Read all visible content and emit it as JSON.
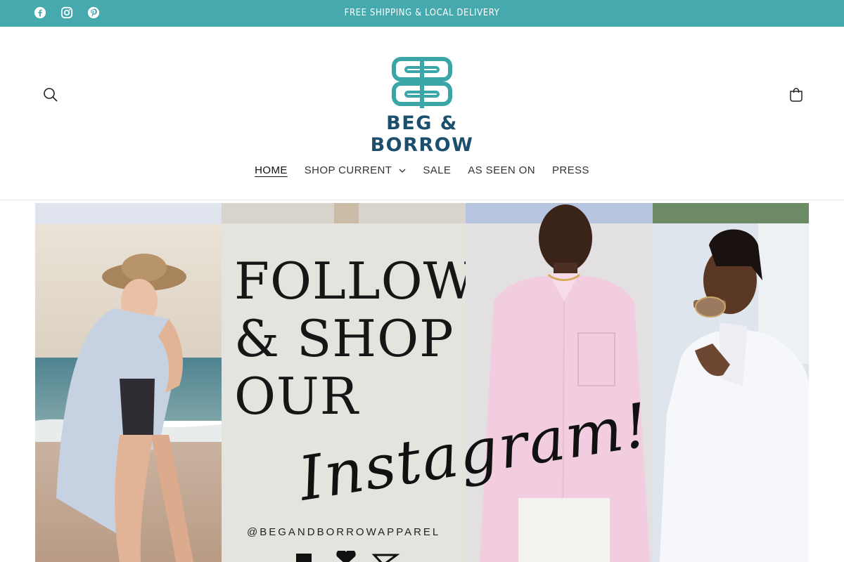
{
  "announcement": {
    "text": "FREE SHIPPING & LOCAL DELIVERY",
    "social": [
      "facebook-icon",
      "instagram-icon",
      "pinterest-icon"
    ]
  },
  "header": {
    "logo_text": "BEG & BORROW",
    "search_icon": "search-icon",
    "cart_icon": "cart-icon"
  },
  "nav": {
    "items": [
      {
        "label": "HOME",
        "active": true
      },
      {
        "label": "SHOP CURRENT",
        "dropdown": true
      },
      {
        "label": "SALE"
      },
      {
        "label": "AS SEEN ON"
      },
      {
        "label": "PRESS"
      }
    ]
  },
  "hero": {
    "heading_line1": "FOLLOW",
    "heading_line2": "& SHOP",
    "heading_line3": "OUR",
    "script": "Instagram!",
    "handle": "@BEGANDBORROWAPPAREL"
  },
  "colors": {
    "announcement_bg": "#45a9ad",
    "logo_teal": "#3aa6a8",
    "logo_navy": "#1c4f6e"
  }
}
